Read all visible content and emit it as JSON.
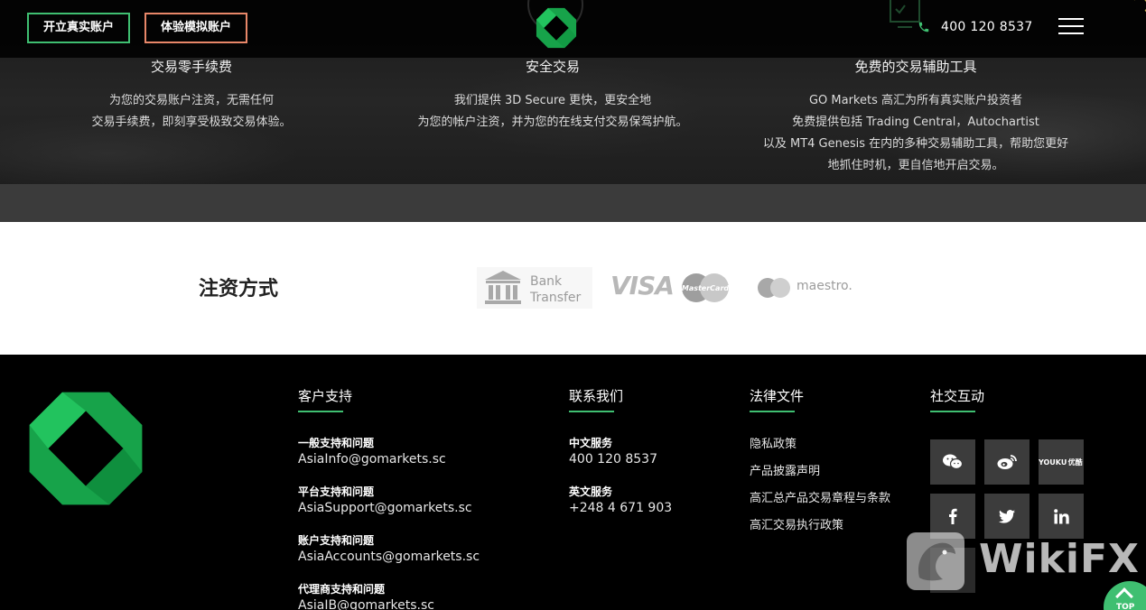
{
  "header": {
    "open_real_account": "开立真实账户",
    "open_demo_account": "体验模拟账户",
    "phone": "400 120 8537",
    "icons": {
      "phone": "phone-icon",
      "menu": "hamburger-menu-icon",
      "logo": "go-markets-logo"
    }
  },
  "features": [
    {
      "title": "交易零手续费",
      "lines": [
        "为您的交易账户注资，无需任何",
        "交易手续费，即刻享受极致交易体验。"
      ]
    },
    {
      "title": "安全交易",
      "lines": [
        "我们提供 3D Secure 更快，更安全地",
        "为您的帐户注资，并为您的在线支付交易保驾护航。"
      ]
    },
    {
      "title": "免费的交易辅助工具",
      "lines": [
        "GO Markets 高汇为所有真实账户投资者",
        "免费提供包括 Trading Central，Autochartist",
        "以及 MT4 Genesis 在内的多种交易辅助工具，帮助您更好",
        "地抓住时机，更自信地开启交易。"
      ]
    }
  ],
  "payment": {
    "title": "注资方式",
    "bank_line1": "Bank",
    "bank_line2": "Transfer",
    "visa": "VISA",
    "mastercard": "MasterCard",
    "maestro": "maestro."
  },
  "footer": {
    "support": {
      "title": "客户支持",
      "entries": [
        {
          "label": "一般支持和问题",
          "value": "AsiaInfo@gomarkets.sc"
        },
        {
          "label": "平台支持和问题",
          "value": "AsiaSupport@gomarkets.sc"
        },
        {
          "label": "账户支持和问题",
          "value": "AsiaAccounts@gomarkets.sc"
        },
        {
          "label": "代理商支持和问题",
          "value": "AsiaIB@gomarkets.sc"
        }
      ]
    },
    "contact": {
      "title": "联系我们",
      "entries": [
        {
          "label": "中文服务",
          "value": "400 120 8537"
        },
        {
          "label": "英文服务",
          "value": "+248 4 671 903"
        }
      ]
    },
    "legal": {
      "title": "法律文件",
      "links": [
        "隐私政策",
        "产品披露声明",
        "高汇总产品交易章程与条款",
        "高汇交易执行政策"
      ]
    },
    "social": {
      "title": "社交互动",
      "icons": [
        "wechat-icon",
        "weibo-icon",
        "youku-icon",
        "facebook-icon",
        "twitter-icon",
        "linkedin-icon"
      ],
      "youku_line1": "YOUKU",
      "youku_line2": "优酷"
    }
  },
  "overlay": {
    "watermark": "WikiFX",
    "back_to_top": "TOP"
  },
  "colors": {
    "accent_green": "#3fbf71",
    "demo_orange": "#e88769"
  }
}
